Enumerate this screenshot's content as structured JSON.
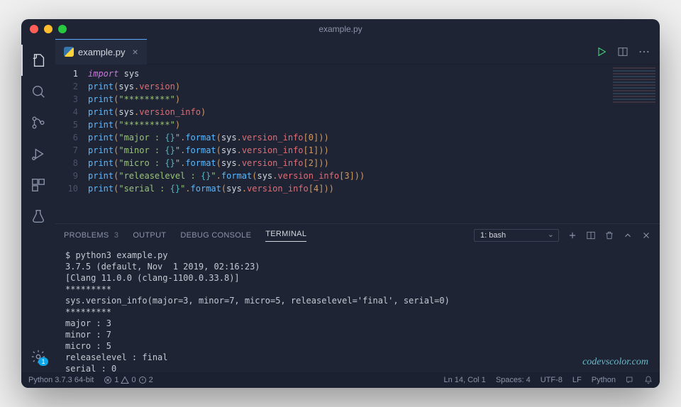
{
  "window": {
    "title": "example.py"
  },
  "tab": {
    "filename": "example.py"
  },
  "activity_badge": "1",
  "code_lines": [
    {
      "n": 1,
      "tokens": [
        [
          "kw",
          "import"
        ],
        [
          "sp",
          " "
        ],
        [
          "mod",
          "sys"
        ]
      ]
    },
    {
      "n": 2,
      "tokens": [
        [
          "fn",
          "print"
        ],
        [
          "p",
          "("
        ],
        [
          "mod",
          "sys"
        ],
        [
          "p",
          "."
        ],
        [
          "prop",
          "version"
        ],
        [
          "p",
          ")"
        ]
      ]
    },
    {
      "n": 3,
      "tokens": [
        [
          "fn",
          "print"
        ],
        [
          "p",
          "("
        ],
        [
          "str",
          "\"*********\""
        ],
        [
          "p",
          ")"
        ]
      ]
    },
    {
      "n": 4,
      "tokens": [
        [
          "fn",
          "print"
        ],
        [
          "p",
          "("
        ],
        [
          "mod",
          "sys"
        ],
        [
          "p",
          "."
        ],
        [
          "prop",
          "version_info"
        ],
        [
          "p",
          ")"
        ]
      ]
    },
    {
      "n": 5,
      "tokens": [
        [
          "fn",
          "print"
        ],
        [
          "p",
          "("
        ],
        [
          "str",
          "\"*********\""
        ],
        [
          "p",
          ")"
        ]
      ]
    },
    {
      "n": 6,
      "tokens": [
        [
          "fn",
          "print"
        ],
        [
          "p",
          "("
        ],
        [
          "str",
          "\"major : "
        ],
        [
          "esc",
          "{}"
        ],
        [
          "str",
          "\""
        ],
        [
          "p",
          "."
        ],
        [
          "fn",
          "format"
        ],
        [
          "p",
          "("
        ],
        [
          "mod",
          "sys"
        ],
        [
          "p",
          "."
        ],
        [
          "prop",
          "version_info"
        ],
        [
          "p",
          "["
        ],
        [
          "num",
          "0"
        ],
        [
          "p",
          "]))"
        ]
      ]
    },
    {
      "n": 7,
      "tokens": [
        [
          "fn",
          "print"
        ],
        [
          "p",
          "("
        ],
        [
          "str",
          "\"minor : "
        ],
        [
          "esc",
          "{}"
        ],
        [
          "str",
          "\""
        ],
        [
          "p",
          "."
        ],
        [
          "fn",
          "format"
        ],
        [
          "p",
          "("
        ],
        [
          "mod",
          "sys"
        ],
        [
          "p",
          "."
        ],
        [
          "prop",
          "version_info"
        ],
        [
          "p",
          "["
        ],
        [
          "num",
          "1"
        ],
        [
          "p",
          "]))"
        ]
      ]
    },
    {
      "n": 8,
      "tokens": [
        [
          "fn",
          "print"
        ],
        [
          "p",
          "("
        ],
        [
          "str",
          "\"micro : "
        ],
        [
          "esc",
          "{}"
        ],
        [
          "str",
          "\""
        ],
        [
          "p",
          "."
        ],
        [
          "fn",
          "format"
        ],
        [
          "p",
          "("
        ],
        [
          "mod",
          "sys"
        ],
        [
          "p",
          "."
        ],
        [
          "prop",
          "version_info"
        ],
        [
          "p",
          "["
        ],
        [
          "num",
          "2"
        ],
        [
          "p",
          "]))"
        ]
      ]
    },
    {
      "n": 9,
      "tokens": [
        [
          "fn",
          "print"
        ],
        [
          "p",
          "("
        ],
        [
          "str",
          "\"releaselevel : "
        ],
        [
          "esc",
          "{}"
        ],
        [
          "str",
          "\""
        ],
        [
          "p",
          "."
        ],
        [
          "fn",
          "format"
        ],
        [
          "p",
          "("
        ],
        [
          "mod",
          "sys"
        ],
        [
          "p",
          "."
        ],
        [
          "prop",
          "version_info"
        ],
        [
          "p",
          "["
        ],
        [
          "num",
          "3"
        ],
        [
          "p",
          "]))"
        ]
      ]
    },
    {
      "n": 10,
      "tokens": [
        [
          "fn",
          "print"
        ],
        [
          "p",
          "("
        ],
        [
          "str",
          "\"serial : "
        ],
        [
          "esc",
          "{}"
        ],
        [
          "str",
          "\""
        ],
        [
          "p",
          "."
        ],
        [
          "fn",
          "format"
        ],
        [
          "p",
          "("
        ],
        [
          "mod",
          "sys"
        ],
        [
          "p",
          "."
        ],
        [
          "prop",
          "version_info"
        ],
        [
          "p",
          "["
        ],
        [
          "num",
          "4"
        ],
        [
          "p",
          "]))"
        ]
      ]
    }
  ],
  "panel": {
    "tabs": {
      "problems": "PROBLEMS",
      "problems_count": "3",
      "output": "OUTPUT",
      "debug": "DEBUG CONSOLE",
      "terminal": "TERMINAL"
    },
    "terminal_select": "1: bash"
  },
  "terminal_lines": [
    "$ python3 example.py",
    "3.7.5 (default, Nov  1 2019, 02:16:23)",
    "[Clang 11.0.0 (clang-1100.0.33.8)]",
    "*********",
    "sys.version_info(major=3, minor=7, micro=5, releaselevel='final', serial=0)",
    "*********",
    "major : 3",
    "minor : 7",
    "micro : 5",
    "releaselevel : final",
    "serial : 0"
  ],
  "terminal_prompt": "$ ",
  "watermark": "codevscolor.com",
  "status": {
    "interpreter": "Python 3.7.3 64-bit",
    "errors": "1",
    "warnings": "0",
    "info": "2",
    "cursor": "Ln 14, Col 1",
    "spaces": "Spaces: 4",
    "encoding": "UTF-8",
    "eol": "LF",
    "language": "Python"
  }
}
